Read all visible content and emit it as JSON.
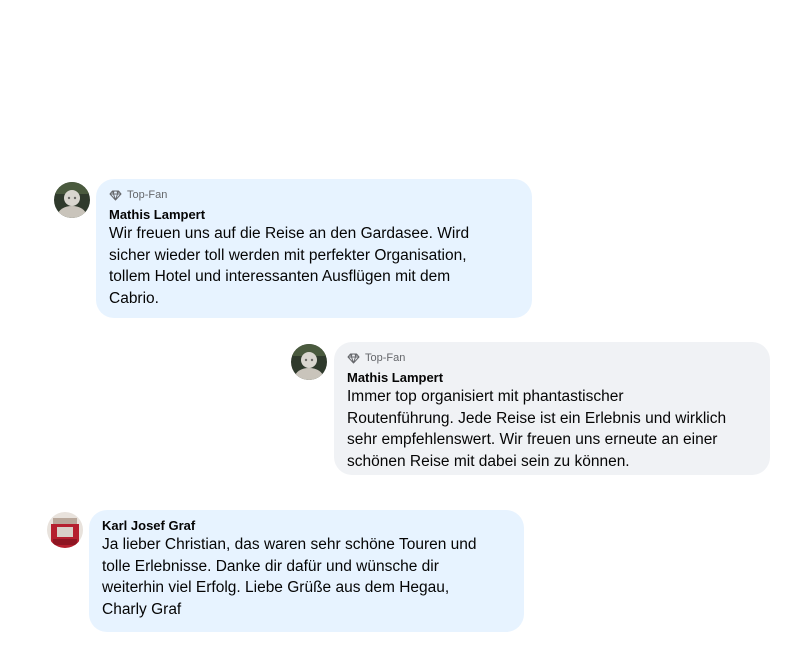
{
  "colors": {
    "bubble_blue": "#e7f3ff",
    "bubble_gray": "#f0f2f5",
    "meta_text": "#65676b",
    "body_text": "#050505"
  },
  "comments": [
    {
      "badge_icon": "diamond-icon",
      "badge": "Top-Fan",
      "author": "Mathis Lampert",
      "text": "Wir freuen uns auf die Reise an den Gardasee. Wird\nsicher wieder toll werden mit perfekter Organisation,\ntollem Hotel und interessanten Ausflügen mit dem\nCabrio."
    },
    {
      "badge_icon": "diamond-icon",
      "badge": "Top-Fan",
      "author": "Mathis Lampert",
      "text": "Immer top organisiert mit phantastischer\nRoutenführung. Jede Reise ist ein Erlebnis und wirklich\nsehr empfehlenswert. Wir freuen uns erneute an einer\nschönen Reise mit dabei sein zu können."
    },
    {
      "author": "Karl Josef Graf",
      "text": "Ja lieber Christian, das waren sehr schöne Touren und\ntolle Erlebnisse. Danke dir dafür und wünsche dir\nweiterhin viel Erfolg. Liebe Grüße aus dem Hegau,\nCharly Graf"
    }
  ]
}
